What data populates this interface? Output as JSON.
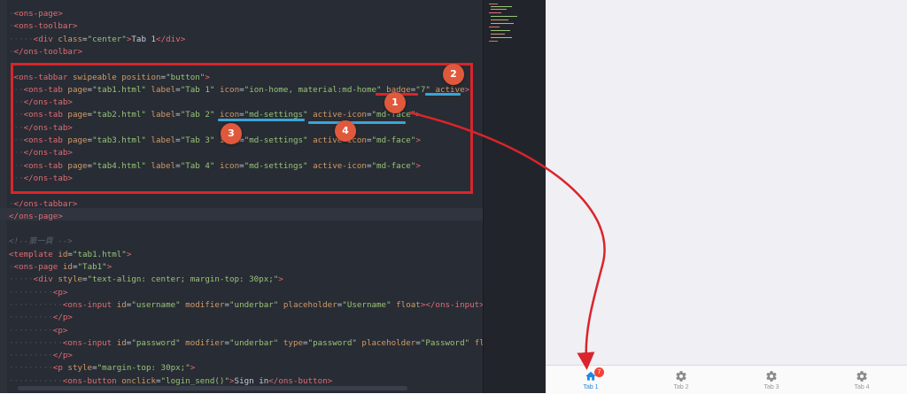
{
  "code_lines": [
    {
      "row": 0,
      "parts": [
        [
          "dots",
          "·"
        ],
        [
          "tag",
          "<ons-page>"
        ]
      ]
    },
    {
      "row": 1,
      "parts": [
        [
          "dots",
          "·"
        ],
        [
          "tag",
          "<ons-toolbar>"
        ]
      ]
    },
    {
      "row": 2,
      "parts": [
        [
          "dots",
          "·····"
        ],
        [
          "tag",
          "<div "
        ],
        [
          "attr",
          "class"
        ],
        [
          "txt",
          "="
        ],
        [
          "str",
          "\"center\""
        ],
        [
          "tag",
          ">"
        ],
        [
          "txt",
          "Tab 1"
        ],
        [
          "tag",
          "</div>"
        ]
      ]
    },
    {
      "row": 3,
      "parts": [
        [
          "dots",
          "·"
        ],
        [
          "tag",
          "</ons-toolbar>"
        ]
      ]
    },
    {
      "row": 4,
      "parts": [
        [
          "txt",
          ""
        ]
      ]
    },
    {
      "row": 5,
      "parts": [
        [
          "dots",
          "·"
        ],
        [
          "tag",
          "<ons-tabbar "
        ],
        [
          "attr",
          "swipeable position"
        ],
        [
          "txt",
          "="
        ],
        [
          "str",
          "\"button\""
        ],
        [
          "tag",
          ">"
        ]
      ]
    },
    {
      "row": 6,
      "parts": [
        [
          "dots",
          "···"
        ],
        [
          "tag",
          "<ons-tab "
        ],
        [
          "attr",
          "page"
        ],
        [
          "txt",
          "="
        ],
        [
          "str",
          "\"tab1.html\""
        ],
        [
          "attr",
          " label"
        ],
        [
          "txt",
          "="
        ],
        [
          "str",
          "\"Tab 1\""
        ],
        [
          "attr",
          " icon"
        ],
        [
          "txt",
          "="
        ],
        [
          "str",
          "\"ion-home, material:md-home\""
        ],
        [
          "attr",
          " badge"
        ],
        [
          "txt",
          "="
        ],
        [
          "str",
          "\"7\""
        ],
        [
          "attr",
          " active"
        ],
        [
          "tag",
          ">"
        ]
      ]
    },
    {
      "row": 7,
      "parts": [
        [
          "dots",
          "···"
        ],
        [
          "tag",
          "</ons-tab>"
        ]
      ]
    },
    {
      "row": 8,
      "parts": [
        [
          "dots",
          "···"
        ],
        [
          "tag",
          "<ons-tab "
        ],
        [
          "attr",
          "page"
        ],
        [
          "txt",
          "="
        ],
        [
          "str",
          "\"tab2.html\""
        ],
        [
          "attr",
          " label"
        ],
        [
          "txt",
          "="
        ],
        [
          "str",
          "\"Tab 2\""
        ],
        [
          "attr",
          " icon"
        ],
        [
          "txt",
          "="
        ],
        [
          "str",
          "\"md-settings\""
        ],
        [
          "attr",
          " active-icon"
        ],
        [
          "txt",
          "="
        ],
        [
          "str",
          "\"md-face\""
        ],
        [
          "tag",
          ">"
        ]
      ]
    },
    {
      "row": 9,
      "parts": [
        [
          "dots",
          "···"
        ],
        [
          "tag",
          "</ons-tab>"
        ]
      ]
    },
    {
      "row": 10,
      "parts": [
        [
          "dots",
          "···"
        ],
        [
          "tag",
          "<ons-tab "
        ],
        [
          "attr",
          "page"
        ],
        [
          "txt",
          "="
        ],
        [
          "str",
          "\"tab3.html\""
        ],
        [
          "attr",
          " label"
        ],
        [
          "txt",
          "="
        ],
        [
          "str",
          "\"Tab 3\""
        ],
        [
          "attr",
          " icon"
        ],
        [
          "txt",
          "="
        ],
        [
          "str",
          "\"md-settings\""
        ],
        [
          "attr",
          " active-icon"
        ],
        [
          "txt",
          "="
        ],
        [
          "str",
          "\"md-face\""
        ],
        [
          "tag",
          ">"
        ]
      ]
    },
    {
      "row": 11,
      "parts": [
        [
          "dots",
          "···"
        ],
        [
          "tag",
          "</ons-tab>"
        ]
      ]
    },
    {
      "row": 12,
      "parts": [
        [
          "dots",
          "···"
        ],
        [
          "tag",
          "<ons-tab "
        ],
        [
          "attr",
          "page"
        ],
        [
          "txt",
          "="
        ],
        [
          "str",
          "\"tab4.html\""
        ],
        [
          "attr",
          " label"
        ],
        [
          "txt",
          "="
        ],
        [
          "str",
          "\"Tab 4\""
        ],
        [
          "attr",
          " icon"
        ],
        [
          "txt",
          "="
        ],
        [
          "str",
          "\"md-settings\""
        ],
        [
          "attr",
          " active-icon"
        ],
        [
          "txt",
          "="
        ],
        [
          "str",
          "\"md-face\""
        ],
        [
          "tag",
          ">"
        ]
      ]
    },
    {
      "row": 13,
      "parts": [
        [
          "dots",
          "···"
        ],
        [
          "tag",
          "</ons-tab>"
        ]
      ]
    },
    {
      "row": 14,
      "parts": [
        [
          "txt",
          ""
        ]
      ]
    },
    {
      "row": 15,
      "parts": [
        [
          "dots",
          "·"
        ],
        [
          "tag",
          "</ons-tabbar>"
        ]
      ]
    },
    {
      "row": 16,
      "parts": [
        [
          "tag",
          "</ons-page>"
        ]
      ]
    },
    {
      "row": 17,
      "parts": [
        [
          "txt",
          ""
        ]
      ]
    },
    {
      "row": 18,
      "parts": [
        [
          "cmt",
          "<!--第一頁 -->"
        ]
      ]
    },
    {
      "row": 19,
      "parts": [
        [
          "tag",
          "<template "
        ],
        [
          "attr",
          "id"
        ],
        [
          "txt",
          "="
        ],
        [
          "str",
          "\"tab1.html\""
        ],
        [
          "tag",
          ">"
        ]
      ]
    },
    {
      "row": 20,
      "parts": [
        [
          "dots",
          "·"
        ],
        [
          "tag",
          "<ons-page "
        ],
        [
          "attr",
          "id"
        ],
        [
          "txt",
          "="
        ],
        [
          "str",
          "\"Tab1\""
        ],
        [
          "tag",
          ">"
        ]
      ]
    },
    {
      "row": 21,
      "parts": [
        [
          "dots",
          "·····"
        ],
        [
          "tag",
          "<div "
        ],
        [
          "attr",
          "style"
        ],
        [
          "txt",
          "="
        ],
        [
          "str",
          "\"text-align: center; margin-top: 30px;\""
        ],
        [
          "tag",
          ">"
        ]
      ]
    },
    {
      "row": 22,
      "parts": [
        [
          "dots",
          "·········"
        ],
        [
          "tag",
          "<p>"
        ]
      ]
    },
    {
      "row": 23,
      "parts": [
        [
          "dots",
          "···········"
        ],
        [
          "tag",
          "<ons-input "
        ],
        [
          "attr",
          "id"
        ],
        [
          "txt",
          "="
        ],
        [
          "str",
          "\"username\""
        ],
        [
          "attr",
          " modifier"
        ],
        [
          "txt",
          "="
        ],
        [
          "str",
          "\"underbar\""
        ],
        [
          "attr",
          " placeholder"
        ],
        [
          "txt",
          "="
        ],
        [
          "str",
          "\"Username\""
        ],
        [
          "attr",
          " float"
        ],
        [
          "tag",
          "></ons-input>"
        ]
      ]
    },
    {
      "row": 24,
      "parts": [
        [
          "dots",
          "·········"
        ],
        [
          "tag",
          "</p>"
        ]
      ]
    },
    {
      "row": 25,
      "parts": [
        [
          "dots",
          "·········"
        ],
        [
          "tag",
          "<p>"
        ]
      ]
    },
    {
      "row": 26,
      "parts": [
        [
          "dots",
          "···········"
        ],
        [
          "tag",
          "<ons-input "
        ],
        [
          "attr",
          "id"
        ],
        [
          "txt",
          "="
        ],
        [
          "str",
          "\"password\""
        ],
        [
          "attr",
          " modifier"
        ],
        [
          "txt",
          "="
        ],
        [
          "str",
          "\"underbar\""
        ],
        [
          "attr",
          " type"
        ],
        [
          "txt",
          "="
        ],
        [
          "str",
          "\"password\""
        ],
        [
          "attr",
          " placeholder"
        ],
        [
          "txt",
          "="
        ],
        [
          "str",
          "\"Password\""
        ],
        [
          "attr",
          " float"
        ],
        [
          "tag",
          ">"
        ]
      ]
    },
    {
      "row": 27,
      "parts": [
        [
          "dots",
          "·········"
        ],
        [
          "tag",
          "</p>"
        ]
      ]
    },
    {
      "row": 28,
      "parts": [
        [
          "dots",
          "·········"
        ],
        [
          "tag",
          "<p "
        ],
        [
          "attr",
          "style"
        ],
        [
          "txt",
          "="
        ],
        [
          "str",
          "\"margin-top: 30px;\""
        ],
        [
          "tag",
          ">"
        ]
      ]
    },
    {
      "row": 29,
      "parts": [
        [
          "dots",
          "···········"
        ],
        [
          "tag",
          "<ons-button "
        ],
        [
          "attr",
          "onclick"
        ],
        [
          "txt",
          "="
        ],
        [
          "str",
          "\"login_send()\""
        ],
        [
          "tag",
          ">"
        ],
        [
          "txt",
          "Sign in"
        ],
        [
          "tag",
          "</ons-button>"
        ]
      ]
    }
  ],
  "callouts": [
    "1",
    "2",
    "3",
    "4"
  ],
  "tabbar": {
    "tabs": [
      {
        "label": "Tab 1",
        "icon": "home-icon",
        "active": true,
        "badge": "7"
      },
      {
        "label": "Tab 2",
        "icon": "gear-icon",
        "active": false
      },
      {
        "label": "Tab 3",
        "icon": "gear-icon",
        "active": false
      },
      {
        "label": "Tab 4",
        "icon": "gear-icon",
        "active": false
      }
    ]
  },
  "colors": {
    "annotation_red": "#d9252b",
    "underline_blue": "#3aa4d8",
    "active_tab": "#1e88e5",
    "badge": "#f44336"
  }
}
